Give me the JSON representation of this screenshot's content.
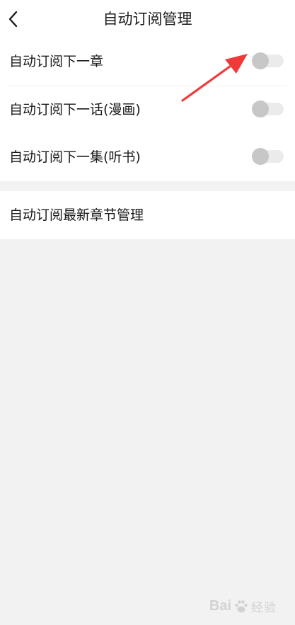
{
  "header": {
    "title": "自动订阅管理",
    "back_icon": "chevron-left-icon"
  },
  "settings": {
    "items": [
      {
        "label": "自动订阅下一章",
        "enabled": false
      },
      {
        "label": "自动订阅下一话(漫画)",
        "enabled": false
      },
      {
        "label": "自动订阅下一集(听书)",
        "enabled": false
      }
    ]
  },
  "latest_chapter": {
    "label": "自动订阅最新章节管理"
  },
  "annotation": {
    "color": "#f03a3a",
    "icon": "red-arrow-annotation"
  },
  "watermark": {
    "brand_a": "Bai",
    "brand_b": "经验",
    "icon": "paw-icon"
  },
  "colors": {
    "page_bg": "#f2f2f2",
    "card_bg": "#ffffff",
    "toggle_track_off": "#ebebeb",
    "toggle_knob_off": "#c7c7c7"
  }
}
